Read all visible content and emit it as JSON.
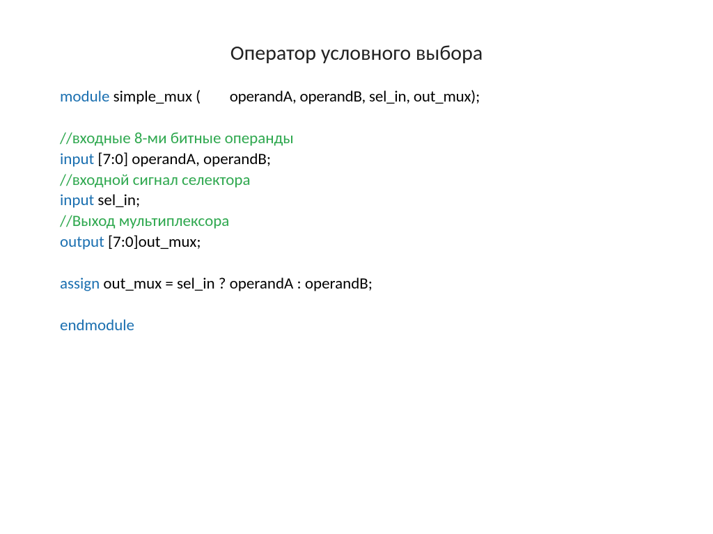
{
  "title": "Оператор условного выбора",
  "code": {
    "l1": {
      "kw": "module",
      "rest1": " simple_mux (",
      "rest2": "operandA, operandB, sel_in, out_mux);"
    },
    "l2": "",
    "l3": "//входные 8-ми битные операнды",
    "l4": {
      "kw": "input",
      "rest": " [7:0] operandA, operandB;"
    },
    "l5": "//входной сигнал селектора",
    "l6": {
      "kw": "input",
      "rest": " sel_in;"
    },
    "l7": "//Выход мультиплексора",
    "l8": {
      "kw": "output",
      "rest": " [7:0]out_mux;"
    },
    "l9": "",
    "l10": {
      "kw": "assign",
      "rest": " out_mux = sel_in ? operandA : operandB;"
    },
    "l11": "",
    "l12": "endmodule"
  }
}
